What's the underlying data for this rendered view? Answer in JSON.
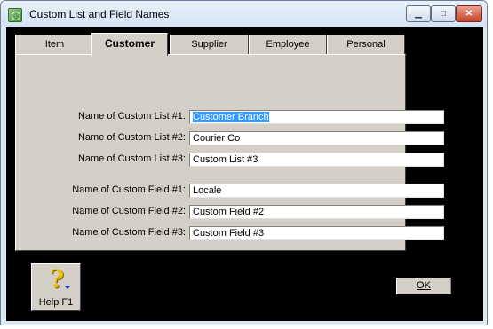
{
  "window": {
    "title": "Custom List and Field Names",
    "buttons": {
      "minimize": "▁",
      "maximize": "□",
      "close": "✕"
    }
  },
  "tabs": [
    "Item",
    "Customer",
    "Supplier",
    "Employee",
    "Personal"
  ],
  "active_tab": "Customer",
  "fields": [
    {
      "label": "Name of Custom List #1:",
      "value": "Customer Branch",
      "selected": true
    },
    {
      "label": "Name of Custom List #2:",
      "value": "Courier Co"
    },
    {
      "label": "Name of Custom List #3:",
      "value": "Custom List #3"
    },
    {
      "label": "Name of Custom Field #1:",
      "value": "Locale"
    },
    {
      "label": "Name of Custom Field #2:",
      "value": "Custom Field #2"
    },
    {
      "label": "Name of Custom Field #3:",
      "value": "Custom Field #3"
    }
  ],
  "help_button": {
    "label": "Help F1",
    "icon": "question-mark-icon"
  },
  "ok_button": {
    "label": "OK"
  }
}
